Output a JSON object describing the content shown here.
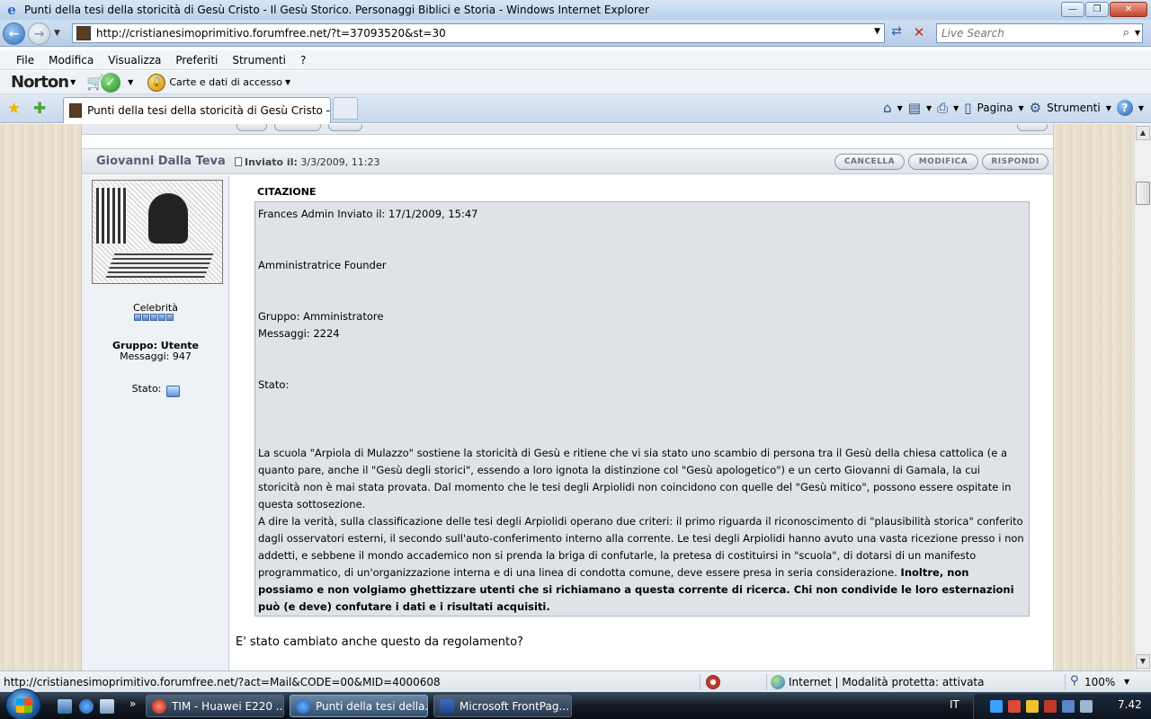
{
  "window": {
    "title": "Punti della tesi della storicità di Gesù Cristo - Il Gesù Storico. Personaggi Biblici e Storia  - Windows Internet Explorer",
    "minimize": "—",
    "restore": "❐",
    "close": "✕"
  },
  "address": {
    "url": "http://cristianesimoprimitivo.forumfree.net/?t=37093520&st=30",
    "search_placeholder": "Live Search"
  },
  "menu": {
    "items": [
      "File",
      "Modifica",
      "Visualizza",
      "Preferiti",
      "Strumenti",
      "?"
    ]
  },
  "norton": {
    "logo": "Norton",
    "identity_label": "Carte e dati di accesso"
  },
  "tabs": {
    "active_label": "Punti della tesi della storicità di Gesù Cristo - Il Ge..."
  },
  "commandbar": {
    "page_label": "Pagina",
    "tools_label": "Strumenti"
  },
  "post": {
    "author": "Giovanni Dalla Teva",
    "posted_label": "Inviato il:",
    "posted_date": "3/3/2009, 11:23",
    "buttons": {
      "delete": "CANCELLA",
      "edit": "MODIFICA",
      "reply": "RISPONDI"
    },
    "user": {
      "rank": "Celebrità",
      "group": "Gruppo: Utente",
      "messages": "Messaggi: 947",
      "status_label": "Stato:"
    },
    "quote_label": "CITAZIONE",
    "quote": {
      "header": "Frances Admin Inviato il: 17/1/2009, 15:47",
      "role": "Amministratrice Founder",
      "group": "Gruppo: Amministratore",
      "messages": "Messaggi: 2224",
      "status": "Stato:",
      "para1": "La scuola \"Arpiola di Mulazzo\" sostiene la storicità di Gesù e ritiene che vi sia stato uno scambio di persona tra il Gesù della chiesa cattolica (e a quanto pare, anche il \"Gesù degli storici\", essendo a loro ignota la distinzione col \"Gesù apologetico\") e un certo Giovanni di Gamala, la cui storicità non è mai stata provata. Dal momento che le tesi degli Arpiolidi non coincidono con quelle del \"Gesù mitico\", possono essere ospitate in questa sottosezione.",
      "para2": "A dire la verità, sulla classificazione delle tesi degli Arpiolidi operano due criteri: il primo riguarda il riconoscimento di \"plausibilità storica\" conferito dagli osservatori esterni, il secondo sull'auto-conferimento interno alla corrente. Le tesi degli Arpiolidi hanno avuto una vasta ricezione presso i non addetti, e sebbene il mondo accademico non si prenda la briga di confutarle, la pretesa di costituirsi in \"scuola\", di dotarsi di un manifesto programmatico, di un'organizzazione interna e di una linea di condotta comune, deve essere presa in seria considerazione.",
      "para2_bold": "Inoltre, non possiamo e non volgiamo ghettizzare utenti che si richiamano a questa corrente di ricerca. Chi non condivide le loro esternazioni può (e deve) confutare i dati e i risultati acquisiti."
    },
    "reply_text": "E' stato cambiato anche questo da regolamento?"
  },
  "statusbar": {
    "link": "http://cristianesimoprimitivo.forumfree.net/?act=Mail&CODE=00&MID=4000608",
    "zone": "Internet | Modalità protetta: attivata",
    "zoom": "100%"
  },
  "taskbar": {
    "tasks": [
      "TIM - Huawei E220 ...",
      "Punti della tesi della...",
      "Microsoft FrontPag..."
    ],
    "language": "IT",
    "clock": "7.42"
  }
}
